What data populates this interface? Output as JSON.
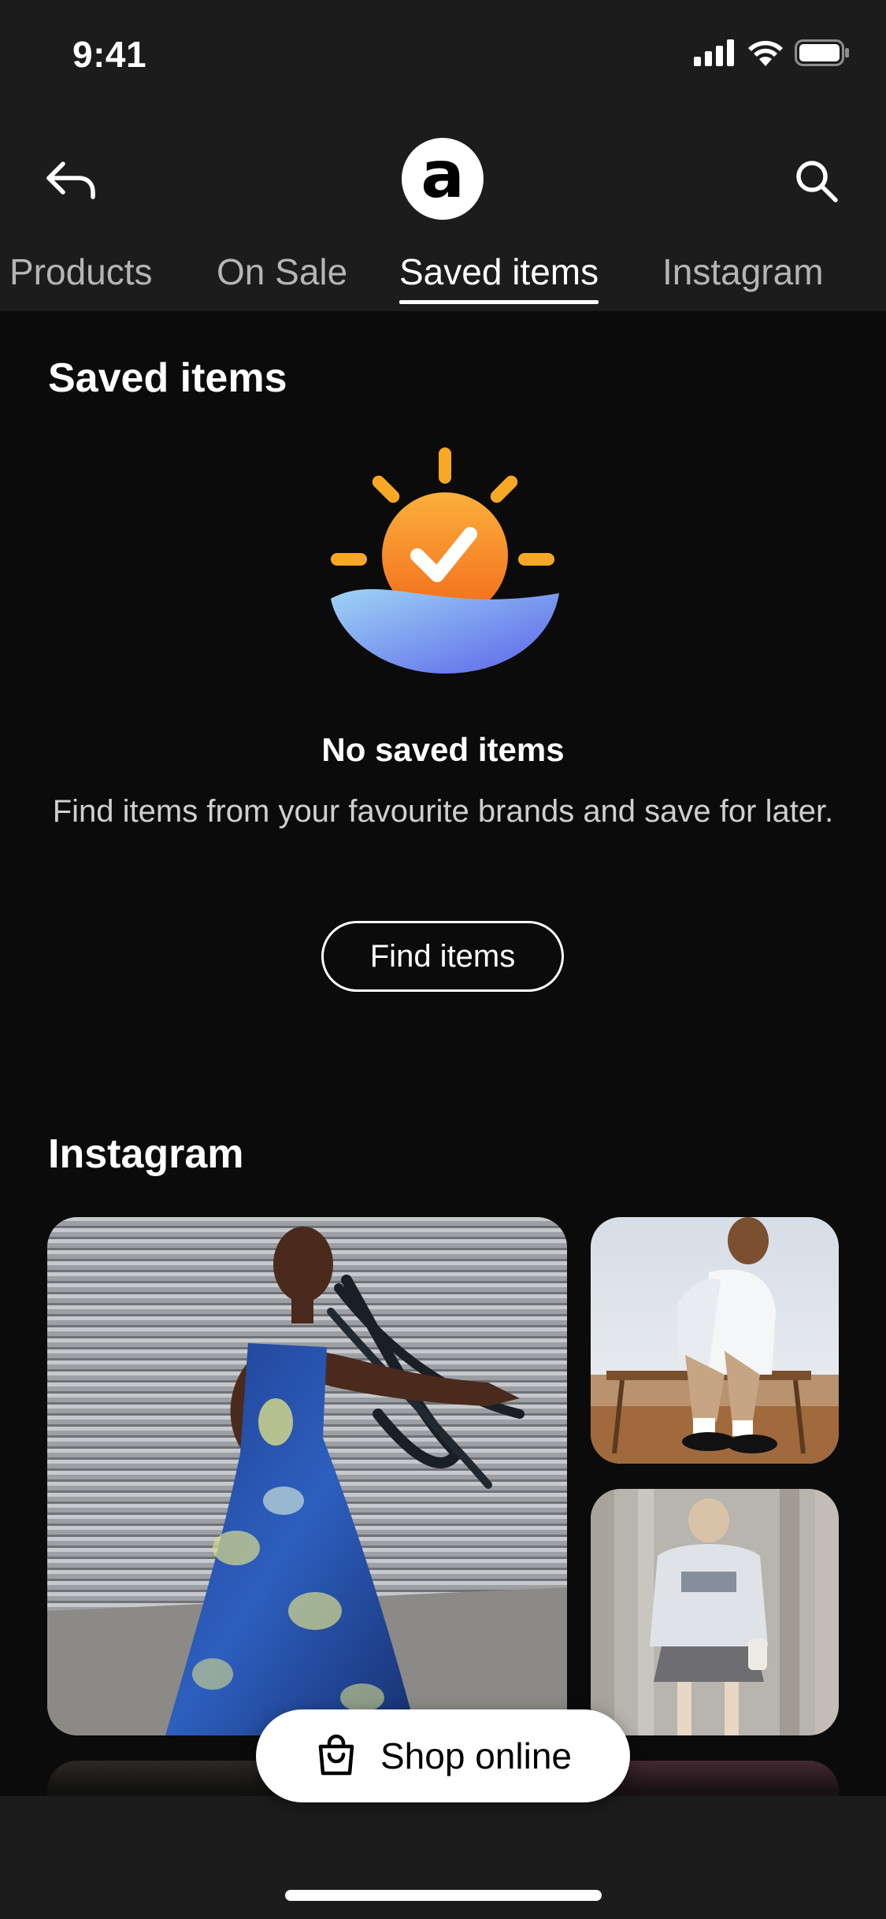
{
  "status_bar": {
    "time": "9:41"
  },
  "header": {
    "logo_letter": "a"
  },
  "tabs": [
    {
      "label": "Products",
      "active": false
    },
    {
      "label": "On Sale",
      "active": false
    },
    {
      "label": "Saved items",
      "active": true
    },
    {
      "label": "Instagram",
      "active": false
    }
  ],
  "saved_section": {
    "title": "Saved items",
    "empty_title": "No saved items",
    "empty_desc": "Find items from your favourite brands and save for later.",
    "find_button": "Find items"
  },
  "instagram_section": {
    "title": "Instagram"
  },
  "shop_button": {
    "label": "Shop online"
  },
  "colors": {
    "accent_sun": "#f9a825",
    "accent_wave": "#6f7ff0",
    "bg": "#0b0b0b",
    "bar": "#1c1c1d"
  },
  "icons": [
    "back-arrow-icon",
    "search-icon",
    "bag-icon",
    "signal-icon",
    "wifi-icon",
    "battery-icon"
  ]
}
